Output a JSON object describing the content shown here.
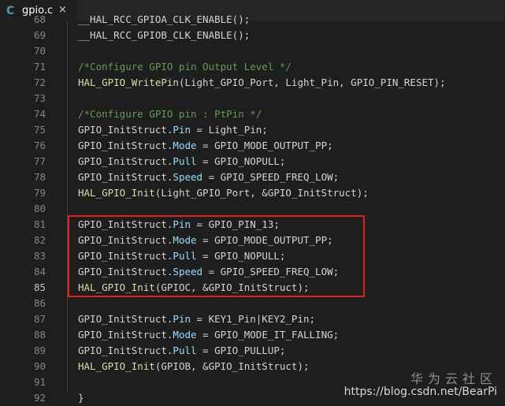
{
  "tab": {
    "icon": "C",
    "title": "gpio.c",
    "close": "×"
  },
  "lines": [
    {
      "n": "68",
      "tokens": [
        [
          "t-ident",
          "  __HAL_RCC_GPIOA_CLK_ENABLE();"
        ]
      ]
    },
    {
      "n": "69",
      "tokens": [
        [
          "t-ident",
          "  __HAL_RCC_GPIOB_CLK_ENABLE();"
        ]
      ]
    },
    {
      "n": "70",
      "tokens": []
    },
    {
      "n": "71",
      "tokens": [
        [
          "t-comment",
          "  /*Configure GPIO pin Output Level */"
        ]
      ]
    },
    {
      "n": "72",
      "tokens": [
        [
          "t-func",
          "  HAL_GPIO_WritePin"
        ],
        [
          "t-punc",
          "(Light_GPIO_Port, Light_Pin, GPIO_PIN_RESET);"
        ]
      ]
    },
    {
      "n": "73",
      "tokens": []
    },
    {
      "n": "74",
      "tokens": [
        [
          "t-comment",
          "  /*Configure GPIO pin : PtPin */"
        ]
      ]
    },
    {
      "n": "75",
      "tokens": [
        [
          "t-ident",
          "  GPIO_InitStruct."
        ],
        [
          "t-prop",
          "Pin"
        ],
        [
          "t-punc",
          " = Light_Pin;"
        ]
      ]
    },
    {
      "n": "76",
      "tokens": [
        [
          "t-ident",
          "  GPIO_InitStruct."
        ],
        [
          "t-prop",
          "Mode"
        ],
        [
          "t-punc",
          " = GPIO_MODE_OUTPUT_PP;"
        ]
      ]
    },
    {
      "n": "77",
      "tokens": [
        [
          "t-ident",
          "  GPIO_InitStruct."
        ],
        [
          "t-prop",
          "Pull"
        ],
        [
          "t-punc",
          " = GPIO_NOPULL;"
        ]
      ]
    },
    {
      "n": "78",
      "tokens": [
        [
          "t-ident",
          "  GPIO_InitStruct."
        ],
        [
          "t-prop",
          "Speed"
        ],
        [
          "t-punc",
          " = GPIO_SPEED_FREQ_LOW;"
        ]
      ]
    },
    {
      "n": "79",
      "tokens": [
        [
          "t-func",
          "  HAL_GPIO_Init"
        ],
        [
          "t-punc",
          "(Light_GPIO_Port, &GPIO_InitStruct);"
        ]
      ]
    },
    {
      "n": "80",
      "tokens": []
    },
    {
      "n": "81",
      "tokens": [
        [
          "t-ident",
          "  GPIO_InitStruct."
        ],
        [
          "t-prop",
          "Pin"
        ],
        [
          "t-punc",
          " = GPIO_PIN_13;"
        ]
      ]
    },
    {
      "n": "82",
      "tokens": [
        [
          "t-ident",
          "  GPIO_InitStruct."
        ],
        [
          "t-prop",
          "Mode"
        ],
        [
          "t-punc",
          " = GPIO_MODE_OUTPUT_PP;"
        ]
      ]
    },
    {
      "n": "83",
      "tokens": [
        [
          "t-ident",
          "  GPIO_InitStruct."
        ],
        [
          "t-prop",
          "Pull"
        ],
        [
          "t-punc",
          " = GPIO_NOPULL;"
        ]
      ]
    },
    {
      "n": "84",
      "tokens": [
        [
          "t-ident",
          "  GPIO_InitStruct."
        ],
        [
          "t-prop",
          "Speed"
        ],
        [
          "t-punc",
          " = GPIO_SPEED_FREQ_LOW;"
        ]
      ]
    },
    {
      "n": "85",
      "active": true,
      "tokens": [
        [
          "t-func",
          "  HAL_GPIO_Init"
        ],
        [
          "t-punc",
          "(GPIOC, &GPIO_InitStruct);"
        ]
      ]
    },
    {
      "n": "86",
      "tokens": []
    },
    {
      "n": "87",
      "tokens": [
        [
          "t-ident",
          "  GPIO_InitStruct."
        ],
        [
          "t-prop",
          "Pin"
        ],
        [
          "t-punc",
          " = KEY1_Pin|KEY2_Pin;"
        ]
      ]
    },
    {
      "n": "88",
      "tokens": [
        [
          "t-ident",
          "  GPIO_InitStruct."
        ],
        [
          "t-prop",
          "Mode"
        ],
        [
          "t-punc",
          " = GPIO_MODE_IT_FALLING;"
        ]
      ]
    },
    {
      "n": "89",
      "tokens": [
        [
          "t-ident",
          "  GPIO_InitStruct."
        ],
        [
          "t-prop",
          "Pull"
        ],
        [
          "t-punc",
          " = GPIO_PULLUP;"
        ]
      ]
    },
    {
      "n": "90",
      "tokens": [
        [
          "t-func",
          "  HAL_GPIO_Init"
        ],
        [
          "t-punc",
          "(GPIOB, &GPIO_InitStruct);"
        ]
      ]
    },
    {
      "n": "91",
      "tokens": []
    },
    {
      "n": "92",
      "tokens": [
        [
          "t-punc",
          "}"
        ]
      ]
    }
  ],
  "watermark": {
    "cn": "华为云社区",
    "url": "https://blog.csdn.net/BearPi"
  },
  "colors": {
    "background": "#1e1e1e",
    "tabbar": "#252526",
    "c_icon": "#519aba",
    "highlight_box": "#e02020",
    "function": "#dcdcaa",
    "property": "#9cdcfe",
    "comment": "#6a9955"
  }
}
